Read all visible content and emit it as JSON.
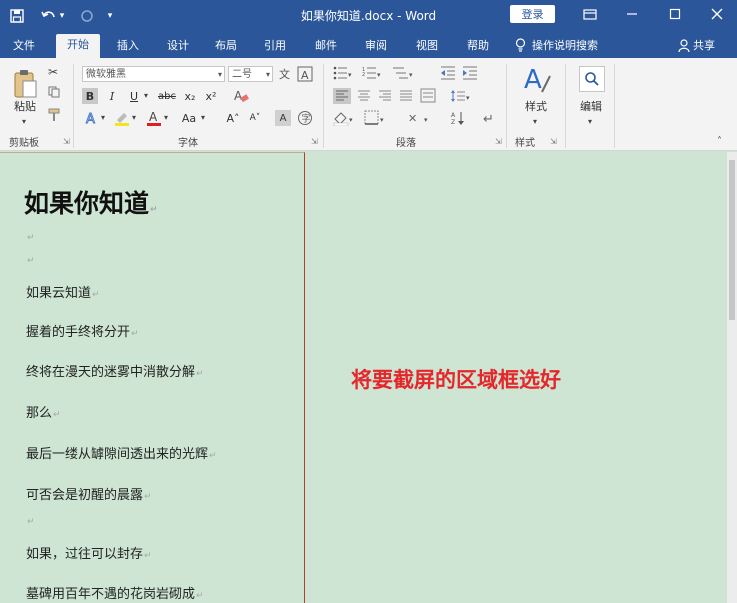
{
  "window": {
    "doc_title": "如果你知道.docx - Word",
    "login_label": "登录",
    "undo_dropdown_glyph": "▾",
    "customize_glyph": "▾"
  },
  "tabs": [
    {
      "label": "文件"
    },
    {
      "label": "开始",
      "active": true
    },
    {
      "label": "插入"
    },
    {
      "label": "设计"
    },
    {
      "label": "布局"
    },
    {
      "label": "引用"
    },
    {
      "label": "邮件"
    },
    {
      "label": "审阅"
    },
    {
      "label": "视图"
    },
    {
      "label": "帮助"
    }
  ],
  "tell_me": "操作说明搜索",
  "share": "共享",
  "ribbon": {
    "clipboard": {
      "paste_label": "粘贴",
      "group_label": "剪贴板"
    },
    "font": {
      "font_name": "微软雅黑",
      "font_size": "二号",
      "buttons": {
        "bold": "B",
        "italic": "I",
        "underline": "U",
        "strike": "abc",
        "sub": "x₂",
        "sup": "x²",
        "grow": "A˄",
        "shrink": "A˅",
        "case": "Aa",
        "clear": "A"
      },
      "group_label": "字体"
    },
    "paragraph": {
      "group_label": "段落"
    },
    "styles": {
      "label": "样式",
      "group_label": "样式"
    },
    "editing": {
      "label": "编辑"
    }
  },
  "document": {
    "title": "如果你知道",
    "paragraph_mark": "↵",
    "lines": [
      {
        "text": ""
      },
      {
        "text": ""
      },
      {
        "text": "如果云知道"
      },
      {
        "text": "握着的手终将分开"
      },
      {
        "text": "终将在漫天的迷雾中消散分解"
      },
      {
        "text": "那么"
      },
      {
        "text": "最后一缕从罅隙间透出来的光辉"
      },
      {
        "text": "可否会是初醒的晨露"
      },
      {
        "text": ""
      },
      {
        "text": "如果，过往可以封存"
      },
      {
        "text": "墓碑用百年不遇的花岗岩砌成"
      }
    ]
  },
  "annotation": "将要截屏的区域框选好",
  "colors": {
    "accent": "#2b579a",
    "page_bg": "#cde5d2",
    "annotation": "#e5262b",
    "selection_border": "#b3402f"
  }
}
